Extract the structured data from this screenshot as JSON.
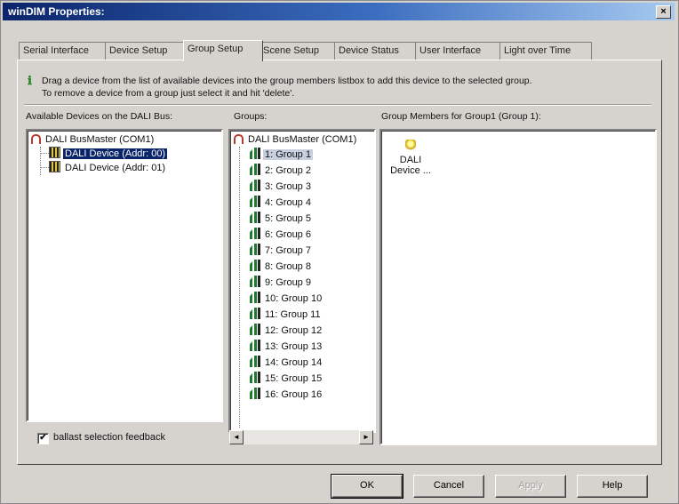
{
  "window": {
    "title": "winDIM Properties:",
    "close_label": "×"
  },
  "tabs": [
    {
      "label": "Serial Interface"
    },
    {
      "label": "Device Setup"
    },
    {
      "label": "Group Setup",
      "active": true
    },
    {
      "label": "Scene Setup"
    },
    {
      "label": "Device Status"
    },
    {
      "label": "User Interface"
    },
    {
      "label": "Light over Time"
    }
  ],
  "info": {
    "line1": "Drag a device from the list of available devices into the group members listbox to add this device to the selected group.",
    "line2": "To remove a device from a group just select it and hit 'delete'."
  },
  "columns": {
    "available_label": "Available Devices on the DALI Bus:",
    "groups_label": "Groups:",
    "members_label": "Group Members for Group1 (Group 1):"
  },
  "available_tree": {
    "root": "DALI BusMaster (COM1)",
    "devices": [
      {
        "label": "DALI Device (Addr: 00)",
        "selected": true
      },
      {
        "label": "DALI Device (Addr: 01)",
        "selected": false
      }
    ]
  },
  "groups_tree": {
    "root": "DALI BusMaster (COM1)",
    "groups": [
      "1: Group 1",
      "2: Group 2",
      "3: Group 3",
      "4: Group 4",
      "5: Group 5",
      "6: Group 6",
      "7: Group 7",
      "8: Group 8",
      "9: Group 9",
      "10: Group 10",
      "11: Group 11",
      "12: Group 12",
      "13: Group 13",
      "14: Group 14",
      "15: Group 15",
      "16: Group 16"
    ],
    "selected_index": 0
  },
  "members": [
    {
      "line1": "DALI",
      "line2": "Device ..."
    }
  ],
  "scrollbar": {
    "left_arrow": "◄",
    "right_arrow": "►"
  },
  "ballast_feedback": {
    "label": "ballast selection feedback",
    "checked": true,
    "mark": "✔"
  },
  "buttons": {
    "ok": "OK",
    "cancel": "Cancel",
    "apply": "Apply",
    "help": "Help"
  }
}
